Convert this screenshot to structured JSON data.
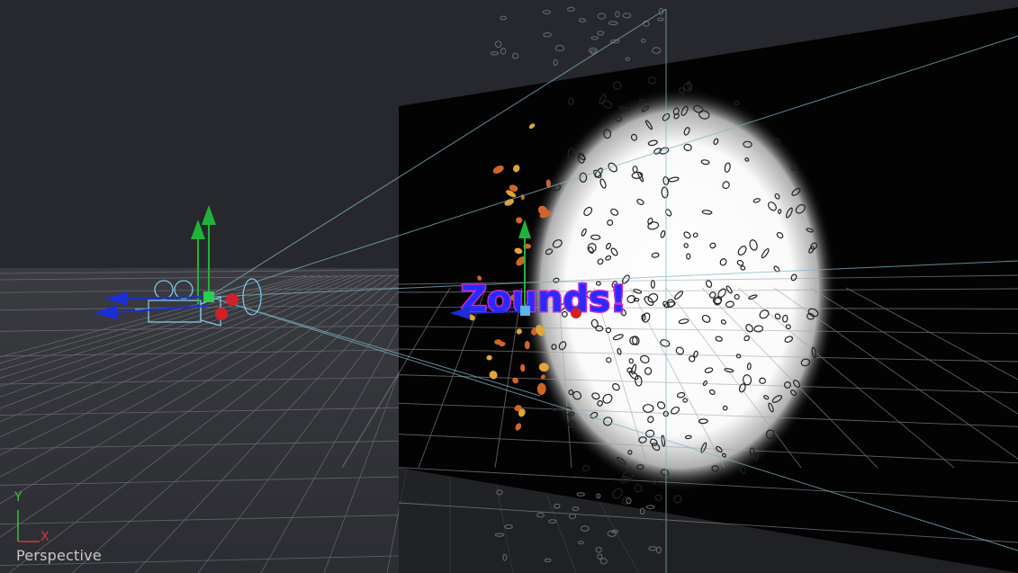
{
  "viewport": {
    "view_name": "Perspective",
    "axis_y_label": "Y",
    "axis_x_label": "X"
  },
  "scene": {
    "text3d": "Zounds!",
    "colors": {
      "background": "#2a2b30",
      "floor": "#2f3035",
      "grid_line": "#8a8d92",
      "frustum_line": "#7fb6c6",
      "backdrop": "#030304",
      "spotlight": "#ffffff",
      "gizmo_x": "#1a2fd6",
      "gizmo_y": "#1fb33a",
      "gizmo_z": "#d0202a",
      "camera_wire": "#7fc8e6",
      "text_fill": "#2a2aff",
      "text_edge": "#c42bd0"
    },
    "icons": [
      "camera-icon",
      "transform-gizmo-icon",
      "axis-triad-icon"
    ]
  }
}
